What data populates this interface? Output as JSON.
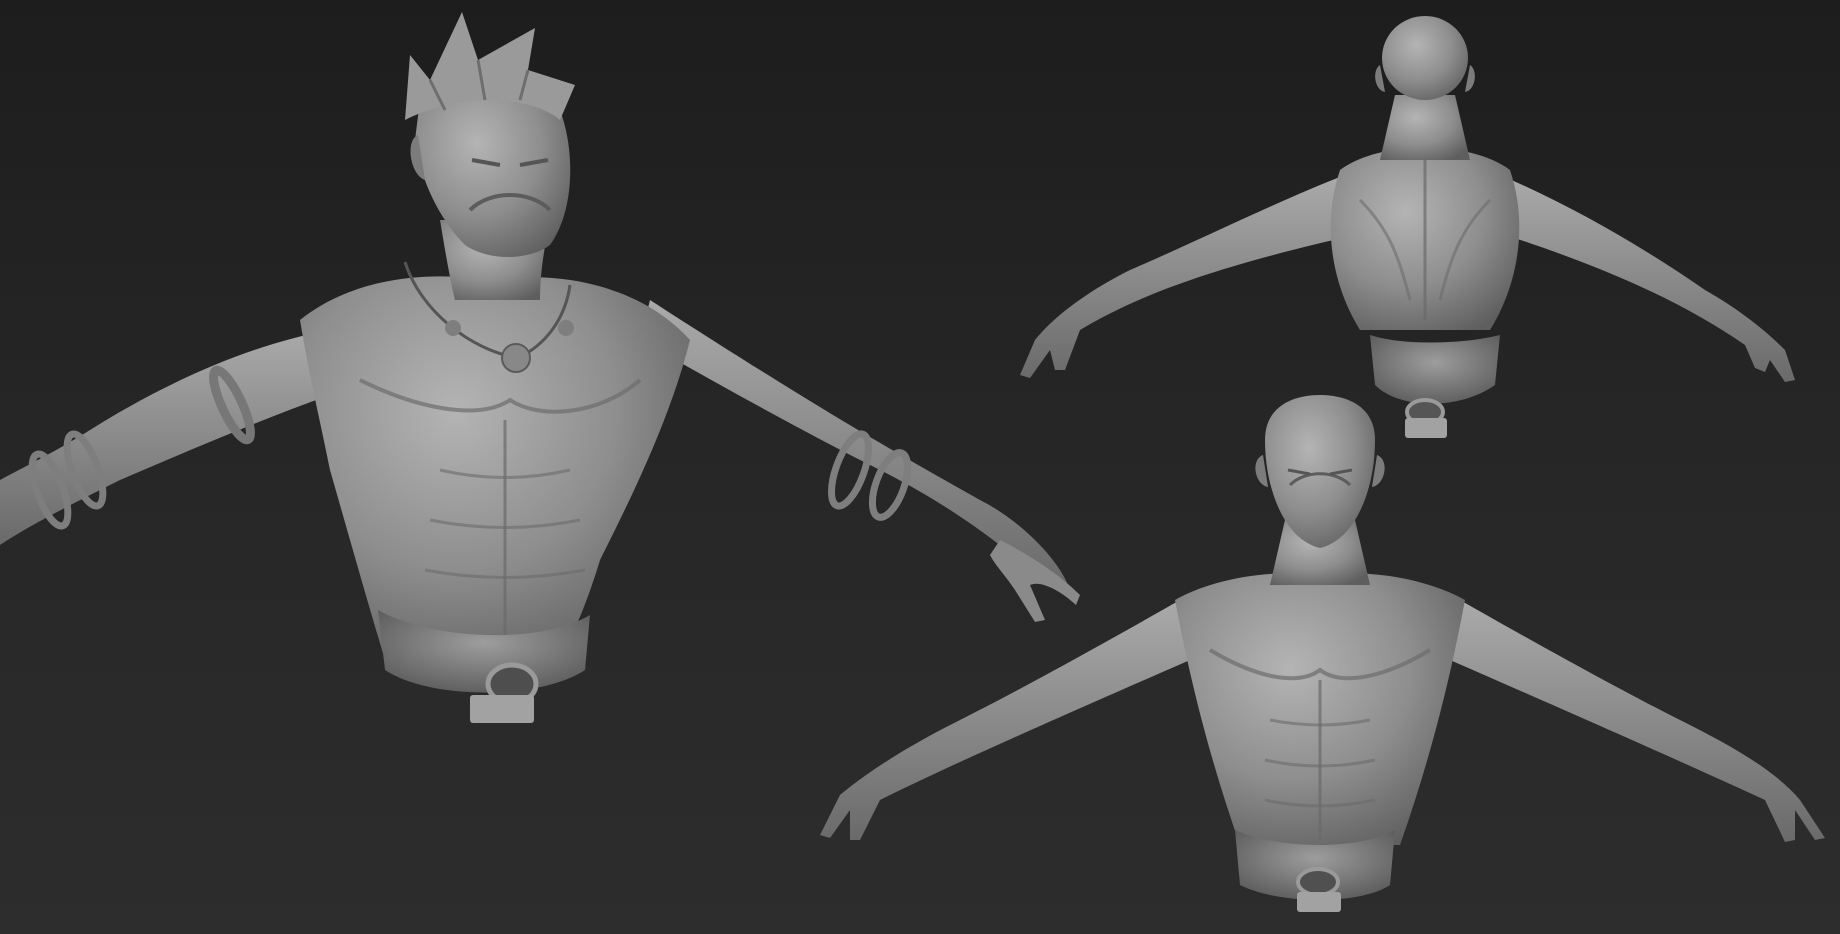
{
  "scene": {
    "background_top": "#1d1d1d",
    "background_bottom": "#2d2d2d",
    "clay_color": "#8f8f8f",
    "views": [
      {
        "view": "front-three-quarter",
        "has_hair": true,
        "has_necklace": true,
        "has_bracelets": true
      },
      {
        "view": "back",
        "has_hair": false
      },
      {
        "view": "front",
        "has_hair": false
      }
    ]
  }
}
